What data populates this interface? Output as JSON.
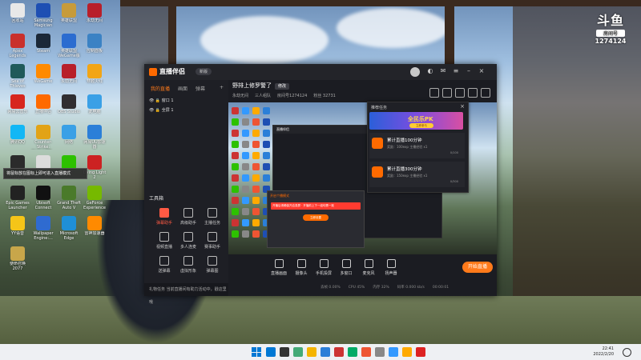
{
  "desktop": {
    "icons": [
      {
        "label": "回收站",
        "color": "#e8e8e8"
      },
      {
        "label": "Samsung Magician",
        "color": "#1e4fb3"
      },
      {
        "label": "英雄联盟",
        "color": "#c79b3b"
      },
      {
        "label": "永劫无间",
        "color": "#b81f2a"
      },
      {
        "label": "Apex Legends",
        "color": "#c9302c"
      },
      {
        "label": "Steam",
        "color": "#1b2838"
      },
      {
        "label": "英雄联盟WeGame版",
        "color": "#2b6cd0"
      },
      {
        "label": "控制面板",
        "color": "#3b82c4"
      },
      {
        "label": "Sea of Thieves",
        "color": "#1f5a5a"
      },
      {
        "label": "WeGame",
        "color": "#ff8a00"
      },
      {
        "label": "永劫无间",
        "color": "#b81f2a"
      },
      {
        "label": "穿越火线",
        "color": "#f2a516"
      },
      {
        "label": "网易云音乐",
        "color": "#d7261e"
      },
      {
        "label": "直播伴侣",
        "color": "#ff6a00"
      },
      {
        "label": "OBS Studio",
        "color": "#302e31"
      },
      {
        "label": "此电脑",
        "color": "#3aa0e6"
      },
      {
        "label": "腾讯QQ",
        "color": "#12b7f5"
      },
      {
        "label": "Counter-Strike: Global Off...",
        "color": "#e2a316"
      },
      {
        "label": "网络",
        "color": "#3aa0e6"
      },
      {
        "label": "网易UU加速器",
        "color": "#2b7fd8"
      },
      {
        "label": "Dread Hunger",
        "color": "#2b2b2b"
      },
      {
        "label": "回收站",
        "color": "#dcdcdc"
      },
      {
        "label": "微信",
        "color": "#2dc100"
      },
      {
        "label": "Dying Light 2",
        "color": "#c22"
      },
      {
        "label": "Epic Games Launcher",
        "color": "#222"
      },
      {
        "label": "Ubisoft Connect",
        "color": "#111"
      },
      {
        "label": "Grand Theft Auto V",
        "color": "#4a7a2a"
      },
      {
        "label": "GeForce Experience",
        "color": "#76b900"
      },
      {
        "label": "YY语音",
        "color": "#f5c518"
      },
      {
        "label": "Wallpaper Engine:...",
        "color": "#2f6bd0"
      },
      {
        "label": "Microsoft Edge",
        "color": "#1f8fd6"
      },
      {
        "label": "雷神加速器",
        "color": "#ff8a00"
      },
      {
        "label": "使命召唤2077",
        "color": "#c8a64a"
      }
    ],
    "tooltip": "将鼠标放在图标上即可进入直播模式"
  },
  "watermark": {
    "logo": "斗鱼",
    "sub": "房间号",
    "room": "1274124"
  },
  "app": {
    "title": "直播伴侣",
    "version": "新版",
    "side_tabs": [
      "我的直播",
      "画面",
      "弹幕"
    ],
    "scenes": [
      "窗口 1",
      "全屏 1"
    ],
    "tool_title": "工具箱",
    "tools": [
      {
        "label": "弹幕助手",
        "active": true
      },
      {
        "label": "高级助手",
        "active": false
      },
      {
        "label": "主播任务",
        "active": false
      },
      {
        "label": "视频直播",
        "active": false
      },
      {
        "label": "多人连麦",
        "active": false
      },
      {
        "label": "赛事助手",
        "active": false
      },
      {
        "label": "送弹幕",
        "active": false
      },
      {
        "label": "虚拟形象",
        "active": false
      },
      {
        "label": "弹幕图",
        "active": false
      }
    ],
    "side_bottom": "礼物任务  当前直播间有助力活动中，戳这里哦",
    "header_title": "野排上修罗警了",
    "header_tag": "修改",
    "sub_info": [
      "永劫无间",
      "三人组队",
      "房间号1274124",
      "粉丝 32731"
    ],
    "mini_title": "直播伴侣",
    "mini_popup_title": "开启个播模式",
    "mini_popup_red": "开播后请确保开启录屏 · 开播前上下一组均需一致",
    "mini_popup_btn": "立即设置",
    "bottom_buttons": [
      "直播画面",
      "摄像头",
      "手机投屏",
      "多窗口",
      "麦克风",
      "扬声器"
    ],
    "start_label": "开始直播",
    "stats": [
      "丢帧 0.00%",
      "CPU 45%",
      "内存 32%",
      "码率 0.000 kb/s",
      "00:00:01"
    ]
  },
  "task_panel": {
    "title": "推荐任务",
    "banner_text": "全民乐PK",
    "banner_btn": "立即参与",
    "items": [
      {
        "name": "累计直播100分钟",
        "desc": "奖励：100exp 主播经验 x1",
        "progress": "0/100"
      },
      {
        "name": "累计直播300分钟",
        "desc": "奖励：150exp 主播经验 x1",
        "progress": "0/300"
      }
    ]
  },
  "taskbar": {
    "time": "22:41",
    "date": "2022/2/20",
    "colors": [
      "#0078d4",
      "#333",
      "#4a7",
      "#f5b400",
      "#2b7fd8",
      "#c33",
      "#0a6",
      "#e53",
      "#888",
      "#39f",
      "#fa0",
      "#d22"
    ]
  }
}
